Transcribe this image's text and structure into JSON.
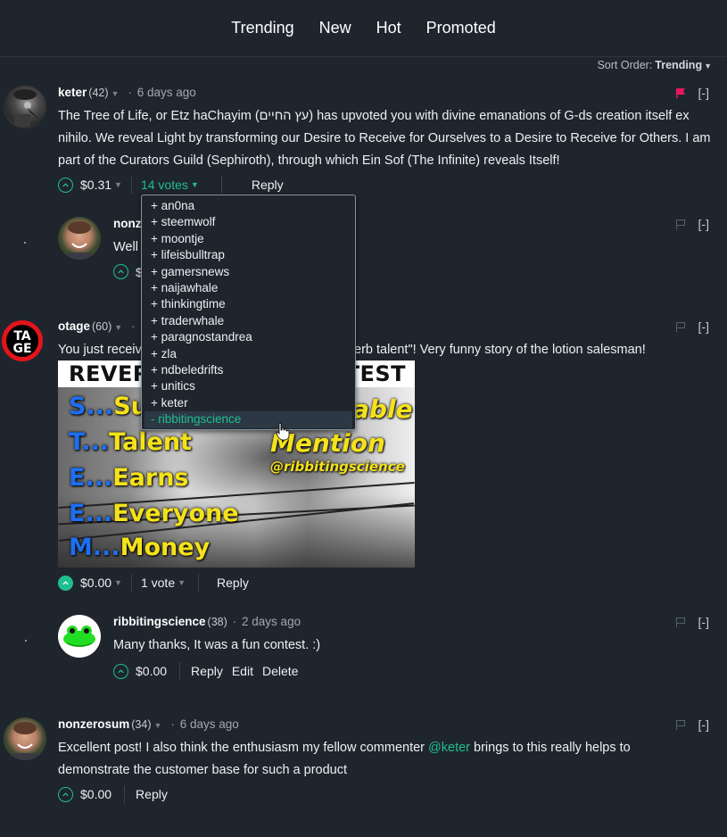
{
  "nav": {
    "tabs": [
      "Trending",
      "New",
      "Hot",
      "Promoted"
    ]
  },
  "sort": {
    "label": "Sort Order:",
    "value": "Trending"
  },
  "colors": {
    "accent": "#1fbf8f",
    "flag_active": "#e8175d",
    "background": "#1e252d"
  },
  "comments": [
    {
      "author": "keter",
      "reputation": "(42)",
      "time": "6 days ago",
      "body": "The Tree of Life, or Etz haChayim (עץ החיים) has upvoted you with divine emanations of G-ds creation itself ex nihilo. We reveal Light by transforming our Desire to Receive for Ourselves to a Desire to Receive for Others. I am part of the Curators Guild (Sephiroth), through which Ein Sof (The Infinite) reveals Itself!",
      "payout": "$0.31",
      "votes": "14 votes",
      "reply": "Reply",
      "collapse": "[-]",
      "flag_icon": "flag-icon-active"
    },
    {
      "author": "nonz",
      "body": "Well",
      "payout": "$",
      "collapse": "[-]"
    },
    {
      "author": "otage",
      "reputation": "(60)",
      "body_start": "You just receiv",
      "body_end": "erb talent\"! Very funny story of the lotion salesman!",
      "payout": "$0.00",
      "votes": "1 vote",
      "reply": "Reply",
      "collapse": "[-]",
      "image": {
        "title_left": "REVER",
        "title_right": "TEST",
        "rows": [
          {
            "letter": "S...",
            "word": "Su"
          },
          {
            "letter": "T...",
            "word": "Talent"
          },
          {
            "letter": "E...",
            "word": "Earns"
          },
          {
            "letter": "E...",
            "word": "Everyone"
          },
          {
            "letter": "M...",
            "word": "Money"
          }
        ],
        "right_1": "able",
        "right_2": "Mention",
        "right_3": "@ribbitingscience"
      }
    },
    {
      "author": "ribbitingscience",
      "reputation": "(38)",
      "time": "2 days ago",
      "body": "Many thanks, It was a fun contest. :)",
      "payout": "$0.00",
      "reply": "Reply",
      "edit": "Edit",
      "delete": "Delete",
      "collapse": "[-]"
    },
    {
      "author": "nonzerosum",
      "reputation": "(34)",
      "time": "6 days ago",
      "body_before": "Excellent post! I also think the enthusiasm my fellow commenter ",
      "mention": "@keter",
      "body_after": " brings to this really helps to demonstrate the customer base for such a product",
      "payout": "$0.00",
      "reply": "Reply",
      "collapse": "[-]"
    }
  ],
  "voters_popup": {
    "items": [
      "+ an0na",
      "+ steemwolf",
      "+ moontje",
      "+ lifeisbulltrap",
      "+ gamersnews",
      "+ naijawhale",
      "+ thinkingtime",
      "+ traderwhale",
      "+ paragnostandrea",
      "+ zla",
      "+ ndbeledrifts",
      "+ unitics",
      "+ keter",
      "- ribbitingscience"
    ]
  }
}
